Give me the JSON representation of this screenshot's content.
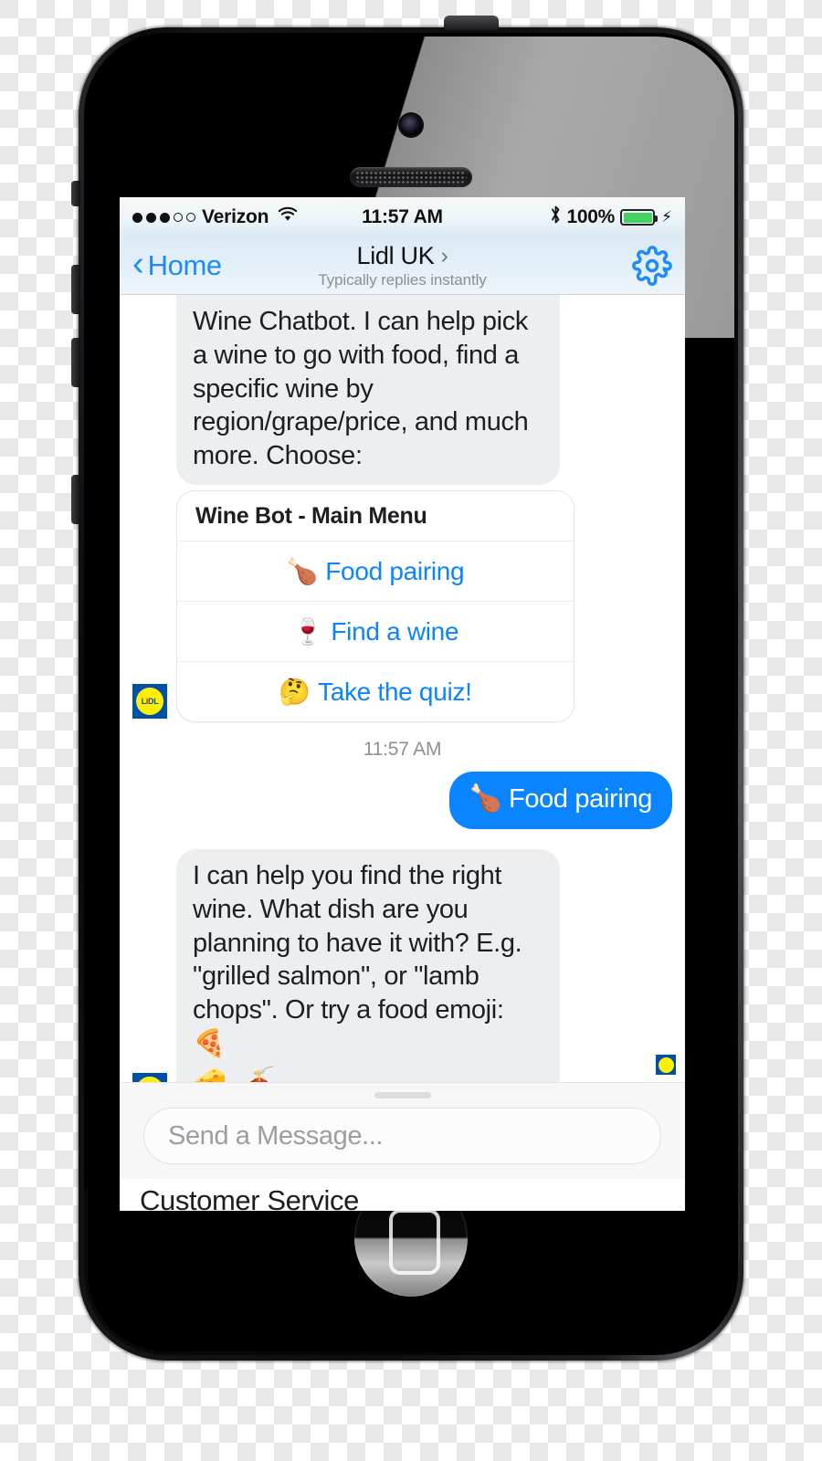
{
  "status_bar": {
    "carrier": "Verizon",
    "signal_filled": 3,
    "signal_total": 5,
    "wifi_icon": "wifi-icon",
    "time": "11:57 AM",
    "bluetooth_icon": "bluetooth-icon",
    "battery_percent": "100%",
    "battery_level": 100,
    "charging_icon": "bolt-icon",
    "battery_color": "#44d362"
  },
  "nav_bar": {
    "back_label": "Home",
    "back_icon": "chevron-left-icon",
    "title": "Lidl UK",
    "title_arrow": "›",
    "subtitle": "Typically replies instantly",
    "settings_icon": "gear-icon",
    "accent_color": "#1f8bfb"
  },
  "thread": {
    "avatar_brand": "LIDL",
    "messages": [
      {
        "type": "incoming-text",
        "text": "Wine Chatbot. I can help pick a wine to go with food, find a specific wine by region/grape/price, and much more. Choose:"
      },
      {
        "type": "menu-card",
        "card_title": "Wine Bot - Main Menu",
        "buttons": [
          {
            "emoji": "🍗",
            "emoji_name": "poultry-leg-emoji",
            "label": "Food pairing"
          },
          {
            "emoji": "🍷",
            "emoji_name": "wine-glass-emoji",
            "label": "Find a wine"
          },
          {
            "emoji": "🤔",
            "emoji_name": "thinking-face-emoji",
            "label": "Take the quiz!"
          }
        ]
      },
      {
        "type": "timestamp",
        "text": "11:57 AM"
      },
      {
        "type": "outgoing-text",
        "emoji": "🍗",
        "emoji_name": "poultry-leg-emoji",
        "text": "Food pairing"
      },
      {
        "type": "incoming-text",
        "text": "I can help you find the right wine. What dish are you planning to have it with? E.g. \"grilled salmon\", or \"lamb chops\". Or try a food emoji: 🍕",
        "emoji_line": "🧀 🍝",
        "emoji_line_names": [
          "cheese-wedge-emoji",
          "spaghetti-emoji"
        ]
      }
    ],
    "seen_indicator": "lidl-seen-avatar"
  },
  "composer": {
    "placeholder": "Send a Message...",
    "drag_handle": "drag-handle"
  },
  "persistent_menu": {
    "label": "Customer Service"
  },
  "colors": {
    "outgoing_bubble": "#0a84ff",
    "incoming_bubble": "#eceef0",
    "link_blue": "#0a84ff",
    "lidl_blue": "#0050aa",
    "lidl_yellow": "#fff000",
    "lidl_red": "#e60a14"
  }
}
